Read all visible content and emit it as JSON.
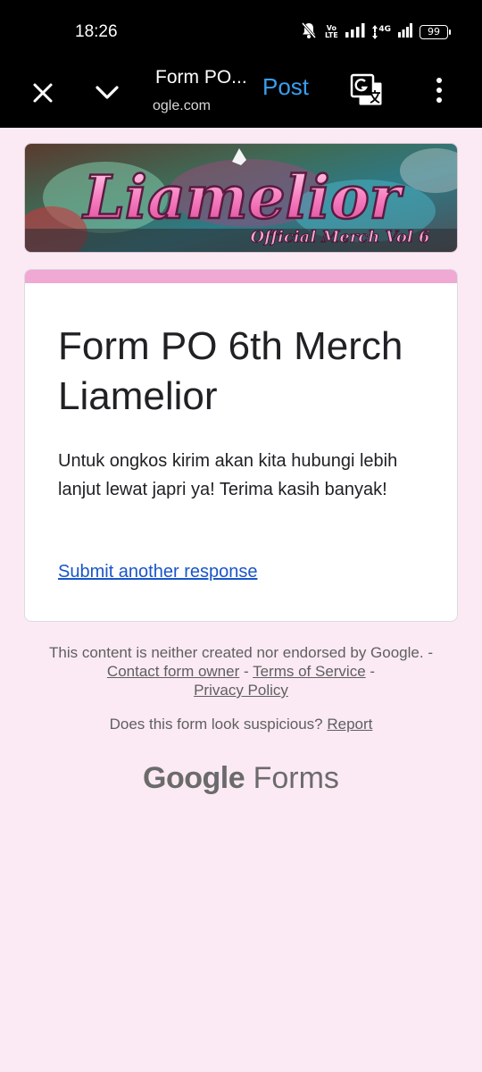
{
  "status_bar": {
    "time": "18:26",
    "volte_label": "Vo\nLTE",
    "network_label": "4G",
    "battery": "99",
    "icons": [
      "mute-icon",
      "signal-icon",
      "data-arrows-icon",
      "signal-icon",
      "battery-icon"
    ]
  },
  "toolbar": {
    "title": "Form PO...",
    "url": "ogle.com",
    "post_label": "Post",
    "icons": [
      "close-icon",
      "chevron-down-icon",
      "translate-icon",
      "more-vert-icon"
    ],
    "post_color": "#3a9ef0"
  },
  "banner": {
    "title_art": "Liamelior",
    "subtitle_art": "Official Merch Vol 6"
  },
  "card": {
    "accent_color": "#f0a9d2",
    "title": "Form PO 6th Merch Liamelior",
    "message": "Untuk ongkos kirim akan kita hubungi lebih lanjut lewat japri ya! Terima kasih banyak!",
    "link": "Submit another response",
    "link_color": "#1a55c9"
  },
  "footer": {
    "disclaimer": "This content is neither created nor endorsed by Google.",
    "sep1": " - ",
    "contact": "Contact form owner",
    "sep2": " - ",
    "terms": "Terms of Service",
    "sep3": " - ",
    "privacy": "Privacy Policy",
    "suspicious": "Does this form look suspicious?",
    "report": "Report",
    "logo_brand": "Google",
    "logo_product": "Forms"
  },
  "colors": {
    "page_background": "#fbeaf4",
    "bar_background": "#000000"
  }
}
